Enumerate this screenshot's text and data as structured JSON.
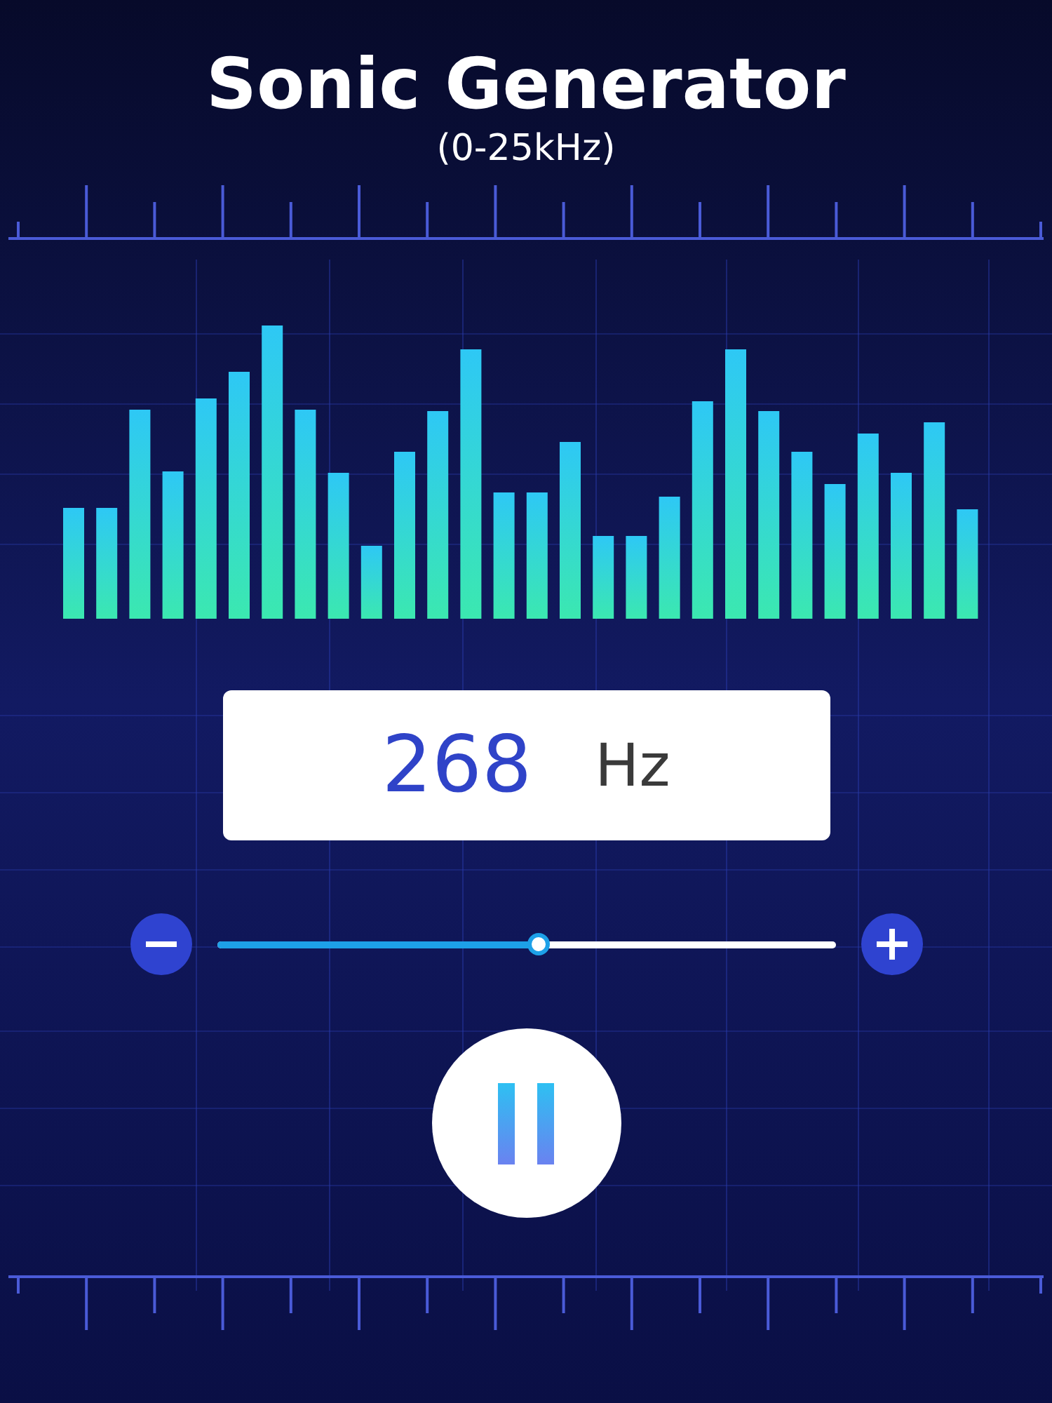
{
  "title": "Sonic Generator",
  "range": "(0-25kHz)",
  "frequency": {
    "value": "268",
    "unit": "Hz"
  },
  "slider": {
    "level": 0.52
  },
  "playing": true
}
